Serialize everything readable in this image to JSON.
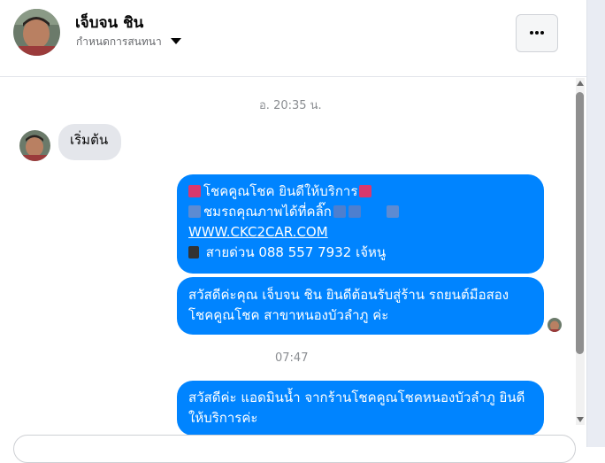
{
  "header": {
    "contact_name": "เจ็บจน ชิน",
    "subtitle": "กำหนดการสนทนา",
    "menu_icon": "more-horizontal-icon",
    "caret_icon": "caret-down-icon"
  },
  "messages": {
    "timestamp_1": "อ. 20:35 น.",
    "incoming_1": "เริ่มต้น",
    "outgoing_1": {
      "line1": "โชคคูณโชค ยินดีให้บริการ",
      "line2": "ชมรถคุณภาพได้ที่คลิ๊ก",
      "line3": "WWW.CKC2CAR.COM",
      "line4": "สายด่วน 088 557 7932 เจ้หนู"
    },
    "outgoing_2": "สวัสดีค่ะคุณ เจ็บจน ชิน ยินดีต้อนรับสู่ร้าน รถยนต์มือสอง โชคคูณโชค สาขาหนองบัวลำภู ค่ะ",
    "timestamp_2": "07:47",
    "outgoing_3": "สวัสดีค่ะ แอดมินน้ำ จากร้านโชคคูณโชคหนองบัวลำภู ยินดีให้บริการค่ะ"
  },
  "colors": {
    "outgoing_bubble": "#0084ff",
    "incoming_bubble": "#e4e6eb",
    "background": "#ffffff"
  }
}
